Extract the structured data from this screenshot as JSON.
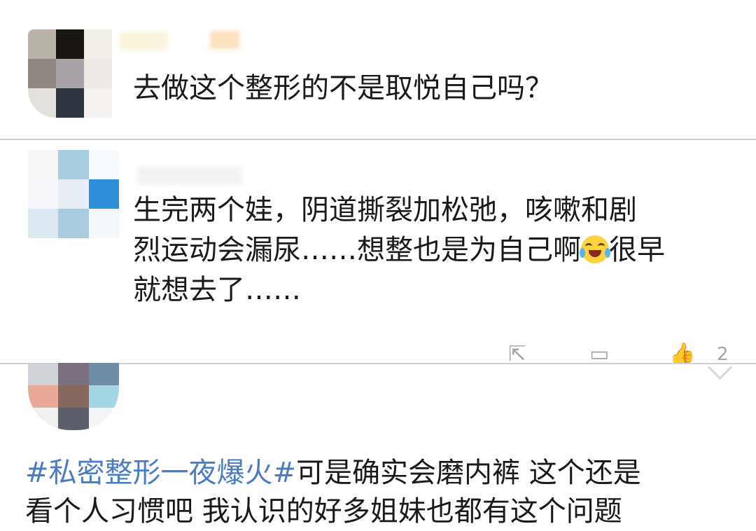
{
  "comments": [
    {
      "text": "去做这个整形的不是取悦自己吗？",
      "avatar_pixels": [
        "#b8b3a8",
        "#191510",
        "#f2efe8",
        "#8f8880",
        "#a7a2a6",
        "#eeeae6",
        "#e4e0dc",
        "#2d3540",
        "#f4f1ee"
      ],
      "username_colors": [
        "#f5ecc0",
        "#f8c98a"
      ]
    },
    {
      "text_lines": [
        "生完两个娃，阴道撕裂加松弛，咳嗽和剧",
        "烈运动会漏尿……想整也是为自己啊",
        "很早",
        "就想去了……"
      ],
      "emoji": "laughing-crying-emoji",
      "avatar_pixels": [
        "#f4f6f8",
        "#a9cde0",
        "#f7fafc",
        "#f6f8fb",
        "#e8eef6",
        "#2e8fd9",
        "#dce8f0",
        "#a9cbe0",
        "#f4f7f9"
      ]
    },
    {
      "hashtag": "#私密整形一夜爆火#",
      "text_after_hashtag": "可是确实会磨内裤 这个还是",
      "text_line2": "看个人习惯吧 我认识的好多姐妹也都有这个问题",
      "avatar_pixels": [
        "#cfd3d8",
        "#7b6f80",
        "#6f8da8",
        "#e9a898",
        "#85695f",
        "#a4d6e4",
        "#eef0f2",
        "#5a5f6a",
        "#f2f4f6"
      ]
    }
  ],
  "actions": {
    "share_icon": "share-icon",
    "comment_icon": "comment-icon",
    "like_icon": "thumbs-up-icon",
    "like_count": "2",
    "expand_icon": "chevron-down-icon"
  },
  "colors": {
    "hashtag": "#4a7cc4",
    "divider": "#cfcfcf",
    "icon": "#a5a5a5"
  }
}
